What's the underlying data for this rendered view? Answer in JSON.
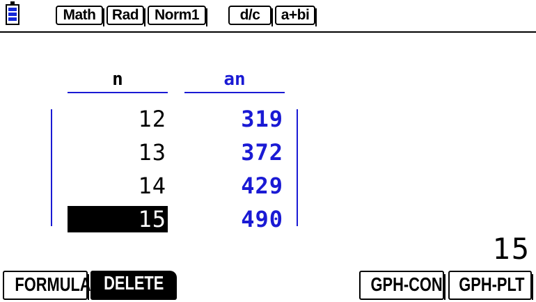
{
  "status_bar": {
    "badges": [
      "Math",
      "Rad",
      "Norm1",
      "d/c",
      "a+bi"
    ],
    "battery_icon": "battery-icon"
  },
  "table": {
    "headers": {
      "n": "n",
      "an": "an"
    },
    "rows": [
      {
        "n": "12",
        "an": "319"
      },
      {
        "n": "13",
        "an": "372"
      },
      {
        "n": "14",
        "an": "429"
      },
      {
        "n": "15",
        "an": "490"
      }
    ],
    "selected_row": 3
  },
  "entry": {
    "value": "15"
  },
  "function_keys": {
    "f1": "FORMULA",
    "f2": "DELETE",
    "f5": "GPH-CON",
    "f6": "GPH-PLT"
  },
  "colors": {
    "accent_blue": "#1a1ad4",
    "battery_blue": "#1428d8",
    "selection": "#000000"
  }
}
